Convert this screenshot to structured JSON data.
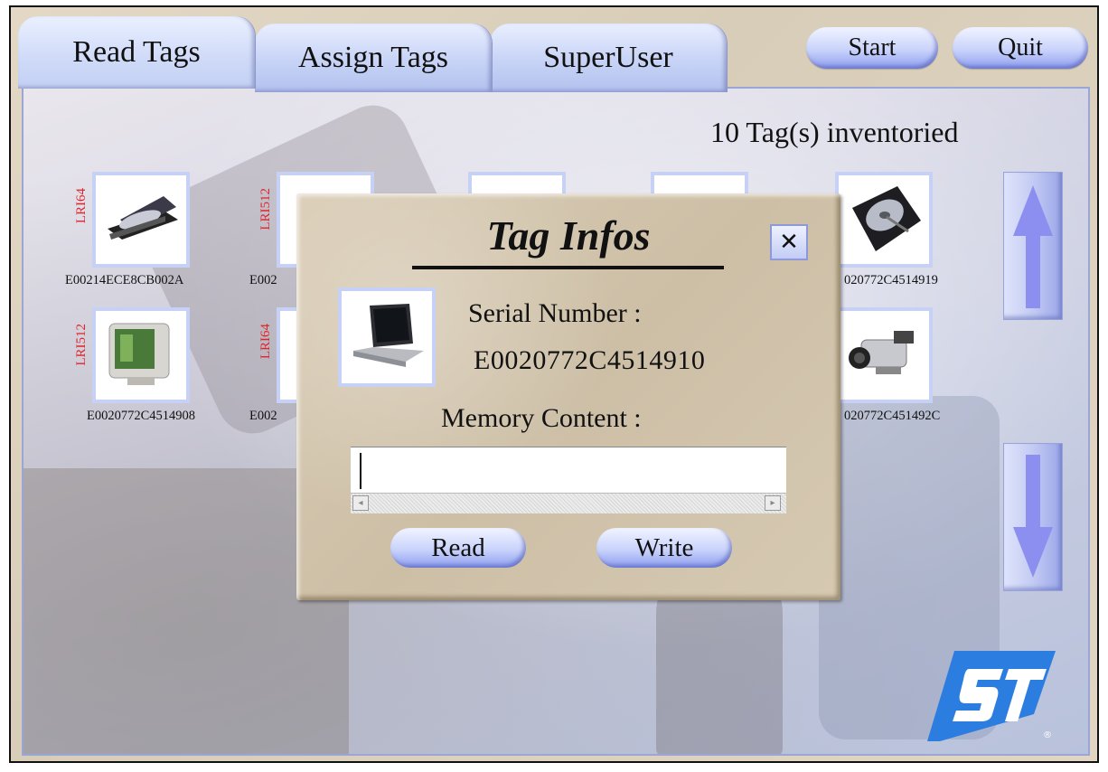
{
  "tabs": [
    {
      "label": "Read Tags",
      "active": true
    },
    {
      "label": "Assign Tags",
      "active": false
    },
    {
      "label": "SuperUser",
      "active": false
    }
  ],
  "toolbar": {
    "start_label": "Start",
    "quit_label": "Quit"
  },
  "inventory": {
    "status_text": "10 Tag(s) inventoried"
  },
  "tags": [
    {
      "type": "LRI64",
      "serial": "E00214ECE8CB002A",
      "icon": "cd-drive-icon"
    },
    {
      "type": "LRI512",
      "serial": "E002",
      "icon": "handheld-icon"
    },
    {
      "type": "",
      "serial": "",
      "icon": "device-icon"
    },
    {
      "type": "",
      "serial": "",
      "icon": "device-icon"
    },
    {
      "type": "",
      "serial": "020772C4514919",
      "icon": "hard-disk-icon"
    },
    {
      "type": "LRI512",
      "serial": "E0020772C4514908",
      "icon": "monitor-icon"
    },
    {
      "type": "LRI64",
      "serial": "E002",
      "icon": "device-icon"
    },
    {
      "type": "",
      "serial": "020772C451492C",
      "icon": "camcorder-icon"
    }
  ],
  "nav": {
    "up_icon": "arrow-up-icon",
    "down_icon": "arrow-down-icon"
  },
  "dialog": {
    "title": "Tag Infos",
    "close_glyph": "✕",
    "serial_label": "Serial Number :",
    "serial_value": "E0020772C4514910",
    "memory_label": "Memory Content :",
    "memory_value": "",
    "scroll_left": "◂",
    "scroll_right": "▸",
    "read_label": "Read",
    "write_label": "Write",
    "icon": "laptop-icon"
  },
  "colors": {
    "tab_blue": "#c7d3f6",
    "tag_type_red": "#e0242c",
    "logo_blue": "#2b7de0"
  }
}
